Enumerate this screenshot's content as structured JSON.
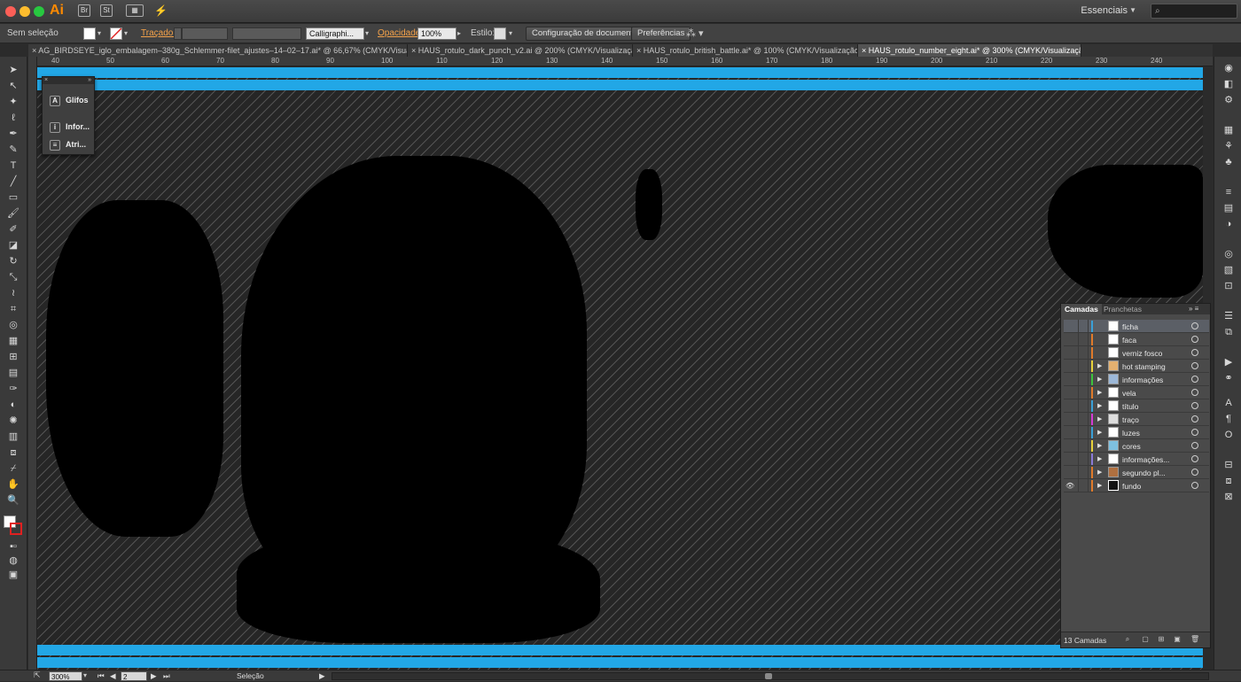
{
  "app": {
    "logo": "Ai",
    "bridge": "Br",
    "stock": "St",
    "workspace": "Essenciais",
    "search_placeholder": ""
  },
  "control": {
    "selection": "Sem seleção",
    "stroke_label": "Traçado:",
    "brush": "Calligraphi...",
    "opacity_label": "Opacidade:",
    "opacity_value": "100%",
    "style_label": "Estilo:",
    "doc_setup": "Configuração de documento",
    "preferences": "Preferências"
  },
  "tabs": [
    {
      "label": "AG_BIRDSEYE_iglo_embalagem–380g_Schlemmer-filet_ajustes–14–02–17.ai* @ 66,67% (CMYK/Visualização)"
    },
    {
      "label": "HAUS_rotulo_dark_punch_v2.ai @ 200% (CMYK/Visualização)"
    },
    {
      "label": "HAUS_rotulo_british_battle.ai* @ 100% (CMYK/Visualização)"
    },
    {
      "label": "HAUS_rotulo_number_eight.ai* @ 300% (CMYK/Visualização)"
    }
  ],
  "ruler": {
    "labels": [
      "40",
      "50",
      "60",
      "70",
      "80",
      "90",
      "100",
      "110",
      "120",
      "130",
      "140",
      "150",
      "160",
      "170",
      "180",
      "190",
      "200",
      "210",
      "220",
      "230",
      "240"
    ]
  },
  "mini_panel": {
    "items": [
      {
        "label": "Glifos"
      },
      {
        "label": "Infor..."
      },
      {
        "label": "Atri..."
      }
    ]
  },
  "layers": {
    "tabs": [
      "Camadas",
      "Pranchetas"
    ],
    "items": [
      {
        "name": "ficha",
        "color": "#3aa0d8"
      },
      {
        "name": "faca",
        "color": "#e07b2a"
      },
      {
        "name": "verniz fosco",
        "color": "#e07b2a"
      },
      {
        "name": "hot stamping",
        "color": "#e8d23a"
      },
      {
        "name": "informações",
        "color": "#3cc43c"
      },
      {
        "name": "vela",
        "color": "#e07b2a"
      },
      {
        "name": "título",
        "color": "#3aa0d8"
      },
      {
        "name": "traço",
        "color": "#d63ad6"
      },
      {
        "name": "luzes",
        "color": "#3aa0d8"
      },
      {
        "name": "cores",
        "color": "#e8d23a"
      },
      {
        "name": "informações...",
        "color": "#8a7ad8"
      },
      {
        "name": "segundo pl...",
        "color": "#e07b2a"
      },
      {
        "name": "fundo",
        "color": "#e07b2a"
      }
    ],
    "count": "13 Camadas"
  },
  "status": {
    "zoom": "300%",
    "artboard": "2",
    "tool": "Seleção"
  }
}
